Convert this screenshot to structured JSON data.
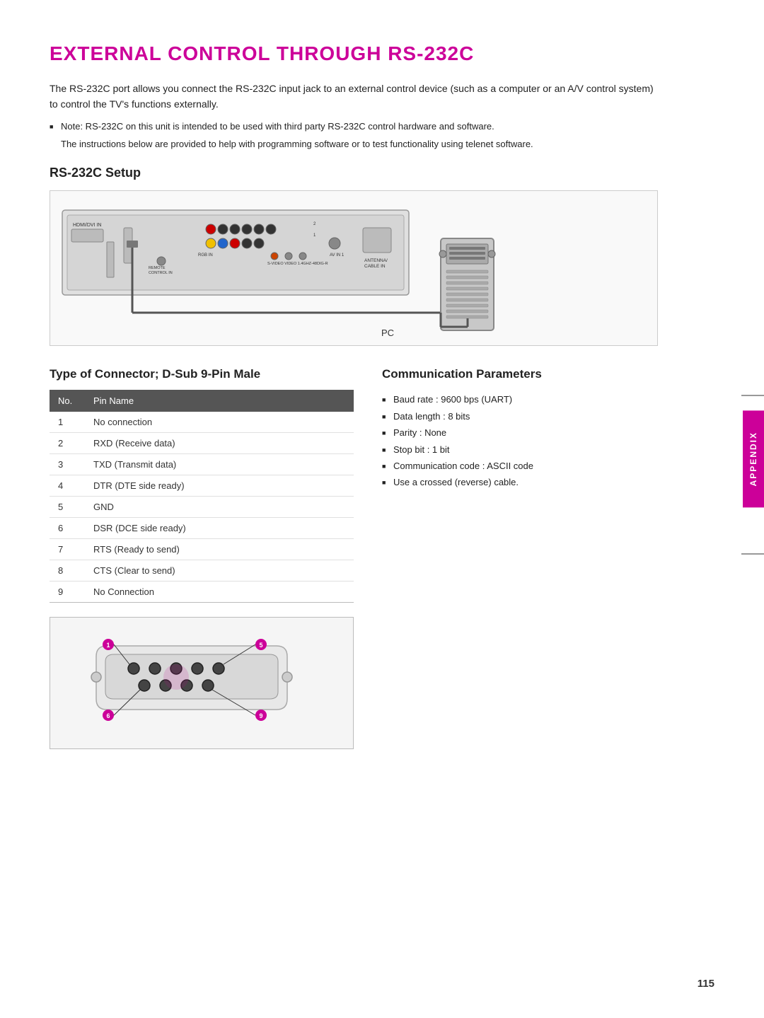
{
  "page": {
    "title": "EXTERNAL CONTROL THROUGH RS-232C",
    "page_number": "115",
    "intro_paragraph": "The RS-232C port allows you connect the RS-232C input jack to an external control device (such as a computer or an A/V control system) to control the TV's functions externally.",
    "note_line1": "Note: RS-232C on this unit is intended to be used with third party RS-232C control hardware and software.",
    "note_line2": "The instructions below are provided to help with programming software or to test functionality using telenet software.",
    "setup_heading": "RS-232C Setup",
    "pc_label": "PC"
  },
  "connector_section": {
    "title": "Type of Connector; D-Sub 9-Pin Male",
    "table": {
      "col_no": "No.",
      "col_pin": "Pin Name",
      "rows": [
        {
          "no": "1",
          "pin": "No connection"
        },
        {
          "no": "2",
          "pin": "RXD (Receive data)"
        },
        {
          "no": "3",
          "pin": "TXD (Transmit data)"
        },
        {
          "no": "4",
          "pin": "DTR (DTE side ready)"
        },
        {
          "no": "5",
          "pin": "GND"
        },
        {
          "no": "6",
          "pin": "DSR (DCE side ready)"
        },
        {
          "no": "7",
          "pin": "RTS (Ready to send)"
        },
        {
          "no": "8",
          "pin": "CTS (Clear to send)"
        },
        {
          "no": "9",
          "pin": "No Connection"
        }
      ]
    },
    "pin_labels": {
      "p1": "1",
      "p5": "5",
      "p6": "6",
      "p9": "9"
    }
  },
  "comm_section": {
    "title": "Communication Parameters",
    "params": [
      "Baud rate : 9600 bps (UART)",
      "Data length : 8 bits",
      "Parity : None",
      "Stop bit : 1 bit",
      "Communication code : ASCII code",
      "Use a crossed (reverse) cable."
    ]
  },
  "appendix": {
    "label": "APPENDIX"
  }
}
